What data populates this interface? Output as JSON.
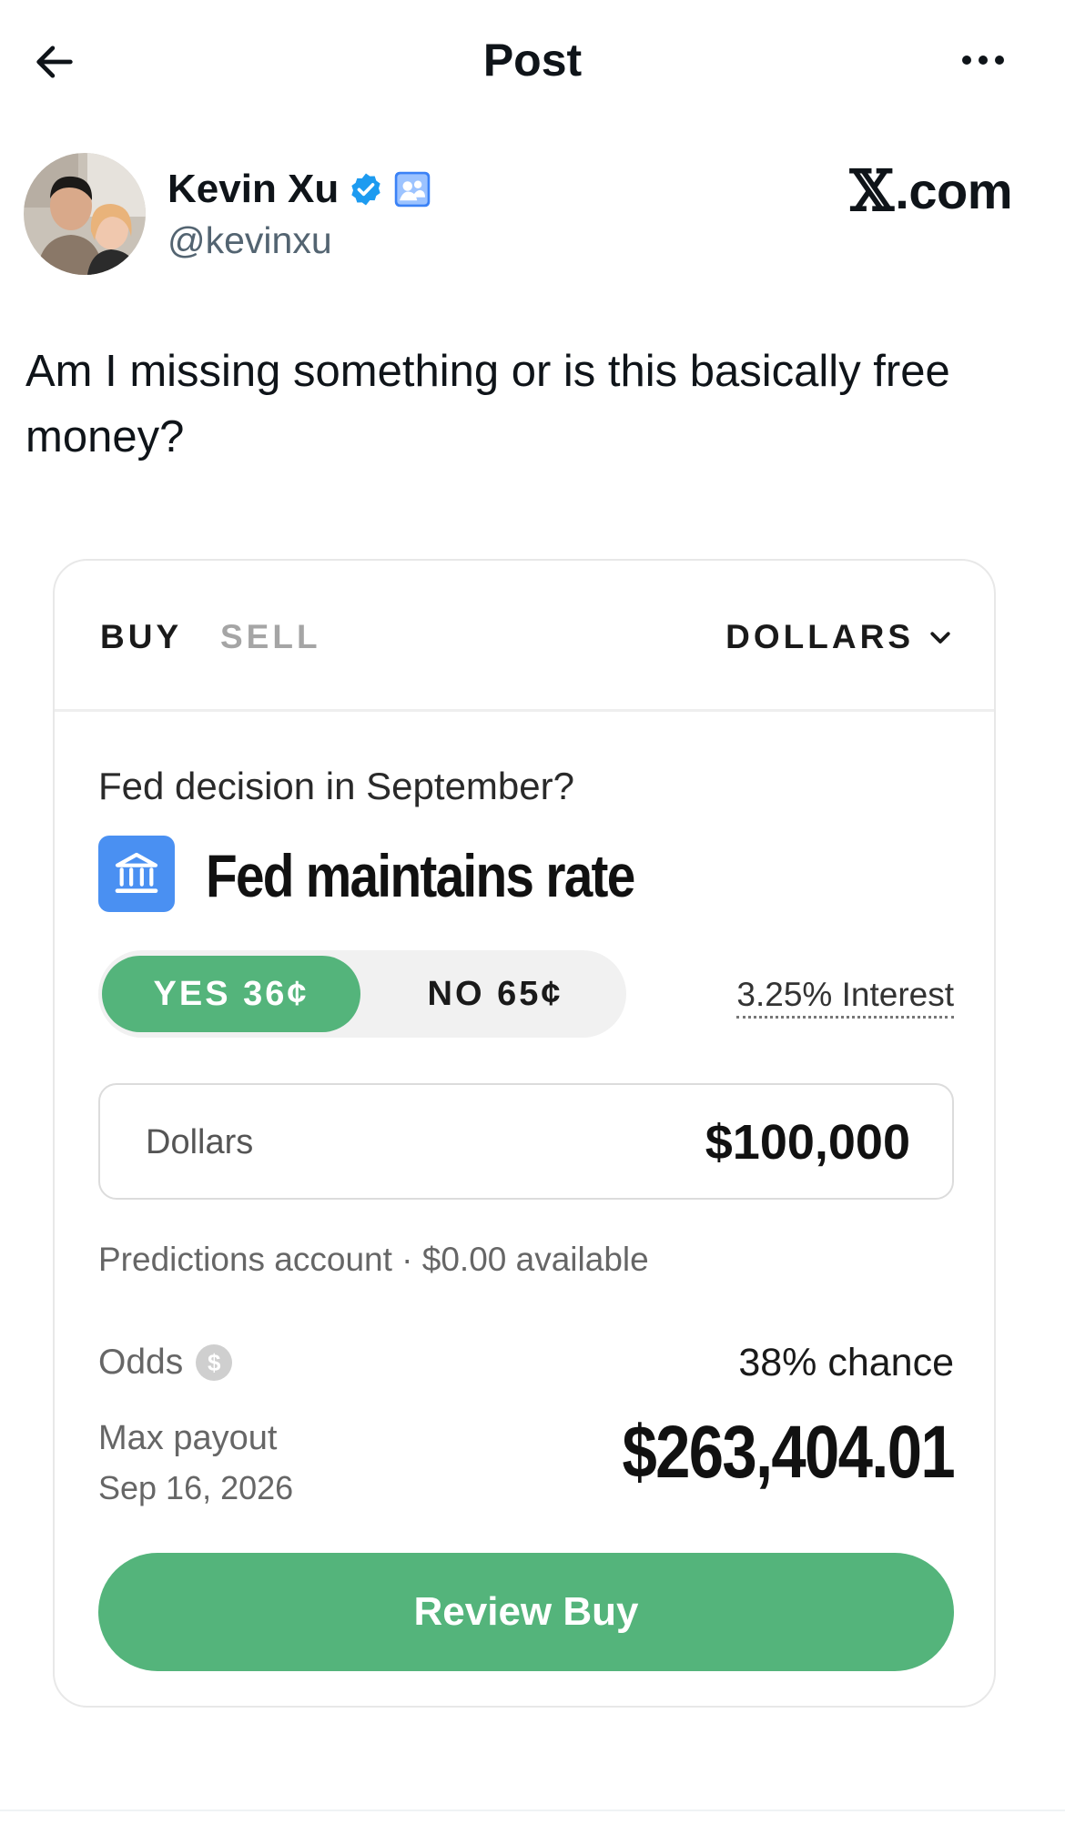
{
  "topbar": {
    "title": "Post",
    "back_icon": "arrow-left-icon",
    "more_icon": "more-horizontal-icon"
  },
  "author": {
    "name": "Kevin Xu",
    "handle": "@kevinxu",
    "verified_icon": "verified-badge-icon",
    "affiliate_icon": "affiliate-badge-icon",
    "verified_color": "#1d9bf0"
  },
  "source": {
    "x_glyph": "𝕏",
    "domain": ".com"
  },
  "post": {
    "text": "Am I missing something or is this basically free money?"
  },
  "card": {
    "tabs": {
      "buy": "BUY",
      "sell": "SELL"
    },
    "currency": {
      "label": "DOLLARS",
      "icon": "chevron-down-icon"
    },
    "question": "Fed decision in September?",
    "market": {
      "title": "Fed maintains rate",
      "icon": "bank-icon",
      "icon_color": "#4a90f2"
    },
    "toggle": {
      "yes": "YES 36¢",
      "no": "NO 65¢",
      "selected": "yes",
      "accent": "#54b47b"
    },
    "interest": "3.25% Interest",
    "amount": {
      "label": "Dollars",
      "value": "$100,000"
    },
    "account": "Predictions account · $0.00 available",
    "odds": {
      "label": "Odds",
      "icon": "dollar-circle-icon",
      "value": "38% chance"
    },
    "payout": {
      "label": "Max payout",
      "date": "Sep 16, 2026",
      "value": "$263,404.01"
    },
    "review_button": "Review Buy"
  }
}
